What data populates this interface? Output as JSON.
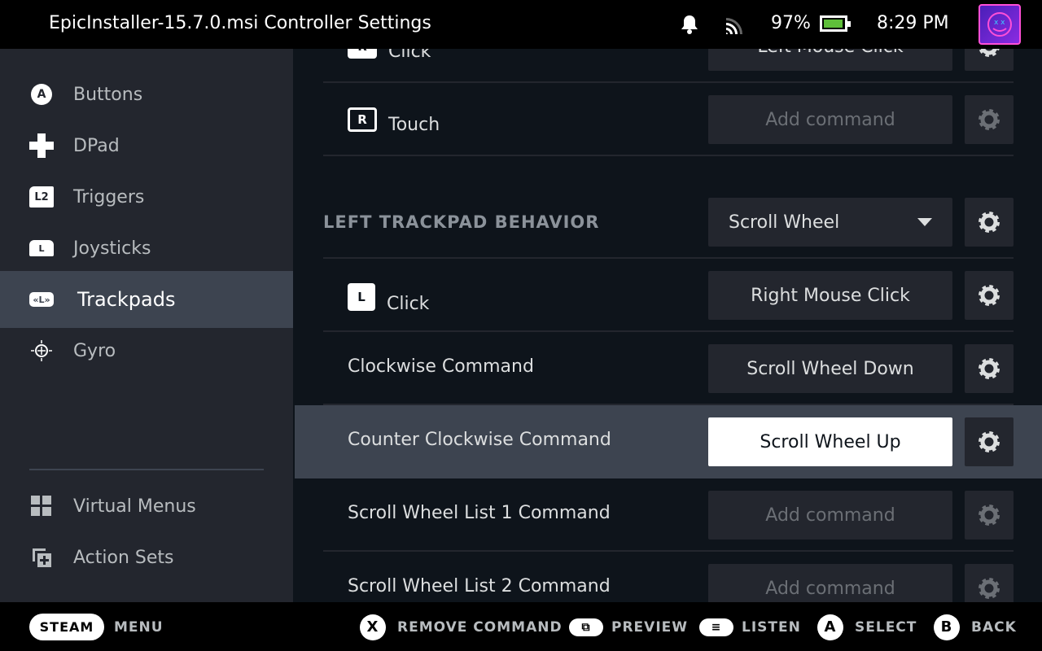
{
  "header": {
    "title": "EpicInstaller-15.7.0.msi Controller Settings",
    "battery_percent": "97%",
    "battery_level": 97,
    "time": "8:29 PM",
    "icons": [
      "bell-icon",
      "cast-icon",
      "battery-icon",
      "avatar"
    ]
  },
  "sidebar": {
    "items": [
      {
        "label": "Buttons",
        "icon": "A"
      },
      {
        "label": "DPad",
        "icon": "dpad-icon"
      },
      {
        "label": "Triggers",
        "icon": "L2"
      },
      {
        "label": "Joysticks",
        "icon": "L"
      },
      {
        "label": "Trackpads",
        "icon": "L",
        "selected": true
      },
      {
        "label": "Gyro",
        "icon": "gyro-icon"
      }
    ],
    "bottom_items": [
      {
        "label": "Virtual Menus",
        "icon": "grid-icon"
      },
      {
        "label": "Action Sets",
        "icon": "add-layer-icon"
      }
    ]
  },
  "main": {
    "rows_top": [
      {
        "key": "R",
        "label": "Click",
        "command": "Left Mouse Click"
      },
      {
        "key": "R",
        "label": "Touch",
        "command": "Add command"
      }
    ],
    "section": {
      "title": "LEFT TRACKPAD BEHAVIOR",
      "value": "Scroll Wheel"
    },
    "rows": [
      {
        "key": "L",
        "label": "Click",
        "command": "Right Mouse Click"
      },
      {
        "label": "Clockwise Command",
        "command": "Scroll Wheel Down"
      },
      {
        "label": "Counter Clockwise Command",
        "command": "Scroll Wheel Up",
        "focused": true
      },
      {
        "label": "Scroll Wheel List 1 Command",
        "command": "Add command"
      },
      {
        "label": "Scroll Wheel List 2 Command",
        "command": "Add command"
      }
    ]
  },
  "footer": {
    "steam": "STEAM",
    "menu": "MENU",
    "hints": [
      {
        "glyph": "X",
        "label": "REMOVE COMMAND"
      },
      {
        "glyph": "view",
        "label": "PREVIEW"
      },
      {
        "glyph": "≡",
        "label": "LISTEN"
      },
      {
        "glyph": "A",
        "label": "SELECT"
      },
      {
        "glyph": "B",
        "label": "BACK"
      }
    ]
  }
}
